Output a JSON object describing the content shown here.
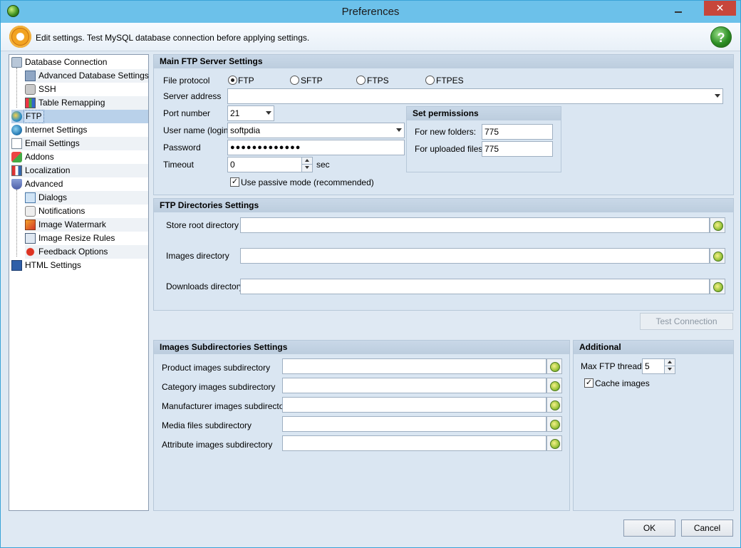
{
  "window": {
    "title": "Preferences"
  },
  "header": {
    "text": "Edit settings. Test MySQL database connection before applying settings."
  },
  "tree": {
    "items": [
      {
        "label": "Database Connection",
        "icon": "database-icon"
      },
      {
        "label": "Advanced Database Settings",
        "icon": "database-settings-icon"
      },
      {
        "label": "SSH",
        "icon": "lock-icon"
      },
      {
        "label": "Table Remapping",
        "icon": "table-icon"
      },
      {
        "label": "FTP",
        "icon": "globe-icon"
      },
      {
        "label": "Internet Settings",
        "icon": "globe-person-icon"
      },
      {
        "label": "Email Settings",
        "icon": "envelope-icon"
      },
      {
        "label": "Addons",
        "icon": "addons-icon"
      },
      {
        "label": "Localization",
        "icon": "flag-icon"
      },
      {
        "label": "Advanced",
        "icon": "shield-icon"
      },
      {
        "label": "Dialogs",
        "icon": "dialog-icon"
      },
      {
        "label": "Notifications",
        "icon": "notification-icon"
      },
      {
        "label": "Image Watermark",
        "icon": "watermark-icon"
      },
      {
        "label": "Image Resize Rules",
        "icon": "resize-icon"
      },
      {
        "label": "Feedback Options",
        "icon": "bug-icon"
      },
      {
        "label": "HTML Settings",
        "icon": "html-icon"
      }
    ]
  },
  "ftp_server": {
    "title": "Main FTP Server Settings",
    "file_protocol_label": "File protocol",
    "protocols": [
      "FTP",
      "SFTP",
      "FTPS",
      "FTPES"
    ],
    "selected_protocol": "FTP",
    "server_address_label": "Server address",
    "server_address_value": "",
    "port_label": "Port number",
    "port_value": "21",
    "username_label": "User name (login)",
    "username_value": "softpdia",
    "password_label": "Password",
    "password_value": "●●●●●●●●●●●●●",
    "timeout_label": "Timeout",
    "timeout_value": "0",
    "timeout_unit": "sec",
    "passive_label": "Use passive mode (recommended)",
    "passive_checked": true
  },
  "permissions": {
    "title": "Set permissions",
    "new_folders_label": "For new folders:",
    "new_folders_value": "775",
    "uploaded_files_label": "For uploaded files:",
    "uploaded_files_value": "775"
  },
  "ftp_dirs": {
    "title": "FTP Directories Settings",
    "store_root_label": "Store root directory",
    "store_root_value": "",
    "images_label": "Images directory",
    "images_value": "",
    "downloads_label": "Downloads directory",
    "downloads_value": ""
  },
  "test_connection_label": "Test Connection",
  "images_subdirs": {
    "title": "Images Subdirectories Settings",
    "rows": [
      {
        "label": "Product images subdirectory",
        "value": ""
      },
      {
        "label": "Category images subdirectory",
        "value": ""
      },
      {
        "label": "Manufacturer images subdirectory",
        "value": ""
      },
      {
        "label": "Media files subdirectory",
        "value": ""
      },
      {
        "label": "Attribute images subdirectory",
        "value": ""
      }
    ]
  },
  "additional": {
    "title": "Additional",
    "max_threads_label": "Max FTP threads",
    "max_threads_value": "5",
    "cache_images_label": "Cache images",
    "cache_images_checked": true
  },
  "footer": {
    "ok_label": "OK",
    "cancel_label": "Cancel"
  }
}
